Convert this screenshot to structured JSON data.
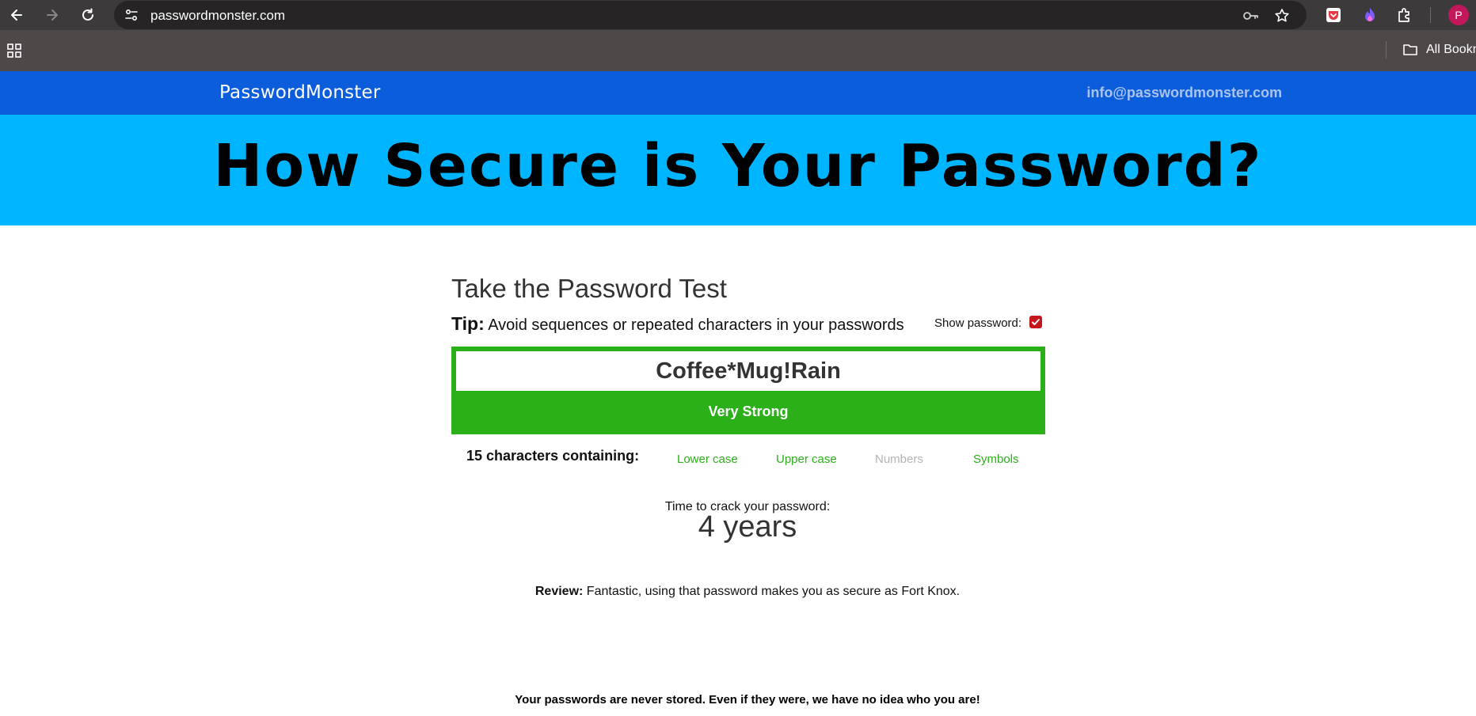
{
  "browser": {
    "url": "passwordmonster.com",
    "bookmarks_label": "All Bookm",
    "profile_initial": "P",
    "ext_colors": {
      "pocket": "#e53945",
      "flame": "#7b5cff",
      "profile": "#c2185b"
    }
  },
  "header": {
    "brand": "PasswordMonster",
    "contact_email": "info@passwordmonster.com"
  },
  "hero": {
    "title": "How Secure is Your Password?"
  },
  "test": {
    "title": "Take the Password Test",
    "tip_label": "Tip:",
    "tip_text": "Avoid sequences or repeated characters in your passwords",
    "show_password_label": "Show password:",
    "show_password_checked": true,
    "password_value": "Coffee*Mug!Rain",
    "strength_label": "Very Strong",
    "strength_color": "#2bb01a",
    "char_count_text": "15 characters containing:",
    "char_types": [
      {
        "label": "Lower case",
        "present": true
      },
      {
        "label": "Upper case",
        "present": true
      },
      {
        "label": "Numbers",
        "present": false
      },
      {
        "label": "Symbols",
        "present": true
      }
    ],
    "crack_label": "Time to crack your password:",
    "crack_value": "4 years",
    "review_label": "Review:",
    "review_text": "Fantastic, using that password makes you as secure as Fort Knox.",
    "footer_note": "Your passwords are never stored. Even if they were, we have no idea who you are!"
  }
}
